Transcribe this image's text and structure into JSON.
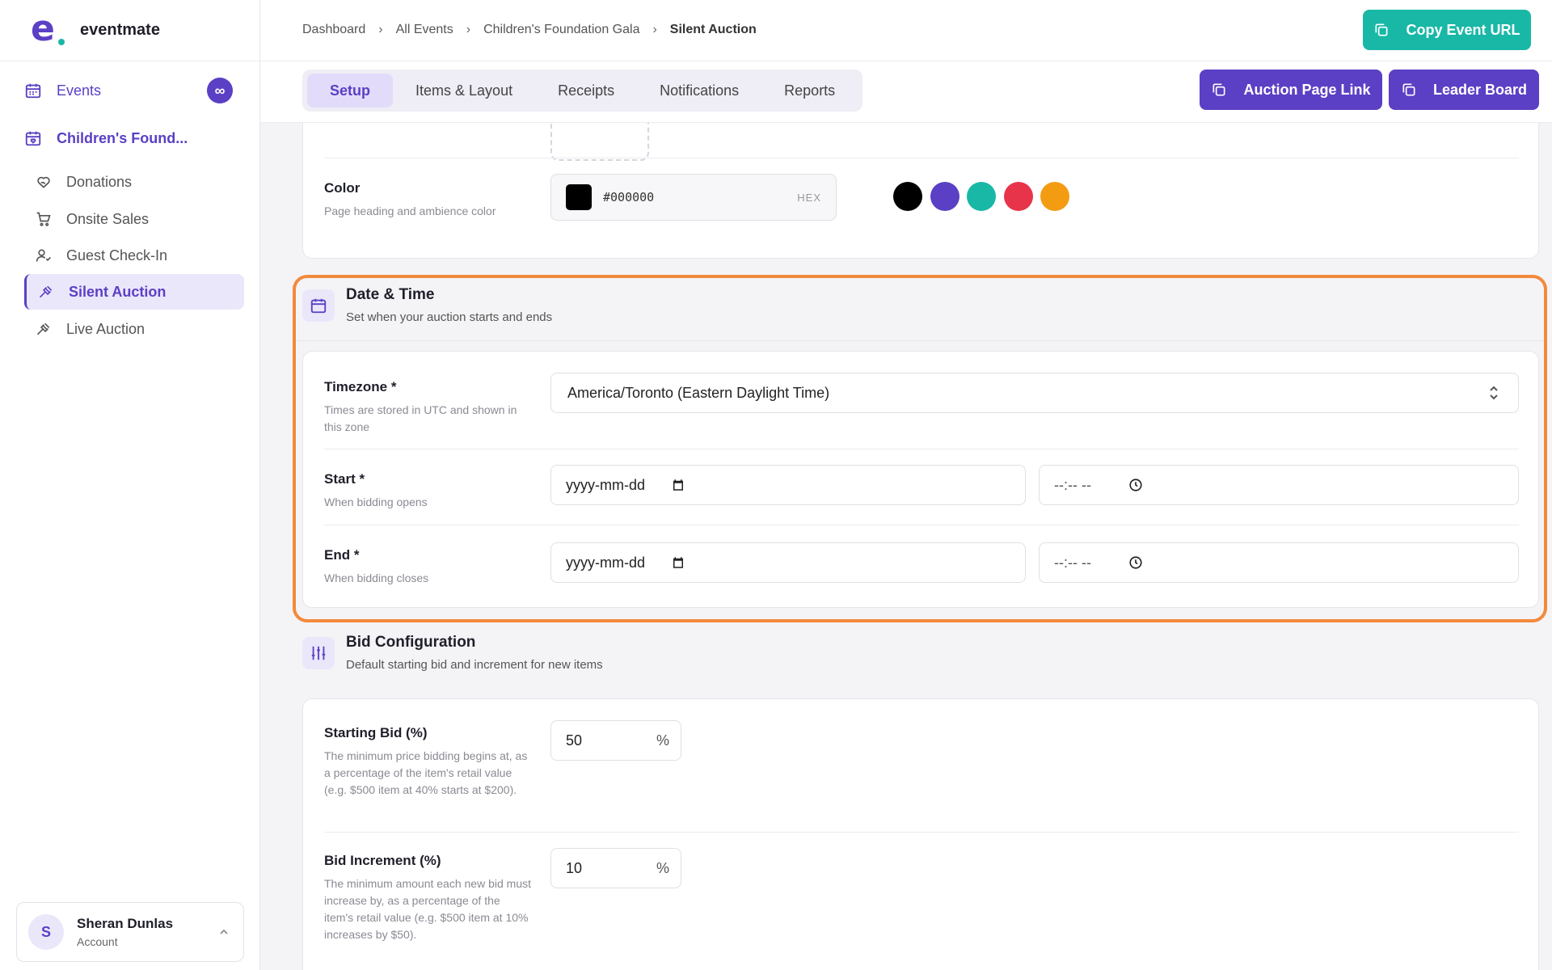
{
  "brand": {
    "name": "eventmate",
    "logo_letter": "e"
  },
  "sidebar": {
    "events_label": "Events",
    "events_badge": "∞",
    "event_name": "Children's Found...",
    "items": [
      {
        "label": "Donations",
        "icon": "heart-hand-icon"
      },
      {
        "label": "Onsite Sales",
        "icon": "cart-icon"
      },
      {
        "label": "Guest Check-In",
        "icon": "user-check-icon"
      },
      {
        "label": "Silent Auction",
        "icon": "gavel-icon",
        "active": true
      },
      {
        "label": "Live Auction",
        "icon": "gavel-icon"
      }
    ],
    "account": {
      "initial": "S",
      "name": "Sheran Dunlas",
      "subtitle": "Account"
    }
  },
  "breadcrumb": [
    "Dashboard",
    "All Events",
    "Children's Foundation Gala",
    "Silent Auction"
  ],
  "header": {
    "copy_url_label": "Copy Event URL"
  },
  "tabs": [
    {
      "label": "Setup",
      "active": true
    },
    {
      "label": "Items & Layout"
    },
    {
      "label": "Receipts"
    },
    {
      "label": "Notifications"
    },
    {
      "label": "Reports"
    }
  ],
  "actions": {
    "auction_page_link": "Auction Page Link",
    "leader_board": "Leader Board"
  },
  "appearance": {
    "color_label": "Color",
    "color_hint": "Page heading and ambience color",
    "color_value": "#000000",
    "hex_label": "HEX",
    "presets": [
      "#000000",
      "#5b3fc4",
      "#19b8a6",
      "#e8344a",
      "#f39c12"
    ]
  },
  "date_time": {
    "title": "Date & Time",
    "subtitle": "Set when your auction starts and ends",
    "timezone_label": "Timezone *",
    "timezone_hint": "Times are stored in UTC and shown in this zone",
    "timezone_value": "America/Toronto (Eastern Daylight Time)",
    "start_label": "Start *",
    "start_hint": "When bidding opens",
    "end_label": "End *",
    "end_hint": "When bidding closes",
    "date_placeholder": "yyyy-mm-dd",
    "time_placeholder": "--:-- --"
  },
  "bid_config": {
    "title": "Bid Configuration",
    "subtitle": "Default starting bid and increment for new items",
    "starting_label": "Starting Bid (%)",
    "starting_hint": "The minimum price bidding begins at, as a percentage of the item's retail value (e.g. $500 item at 40% starts at $200).",
    "starting_value": "50",
    "increment_label": "Bid Increment (%)",
    "increment_hint": "The minimum amount each new bid must increase by, as a percentage of the item's retail value (e.g. $500 item at 10% increases by $50).",
    "increment_value": "10",
    "percent_suffix": "%"
  },
  "colors": {
    "accent": "#5b3fc4",
    "teal": "#19b8a6",
    "highlight": "#f28a3c"
  }
}
